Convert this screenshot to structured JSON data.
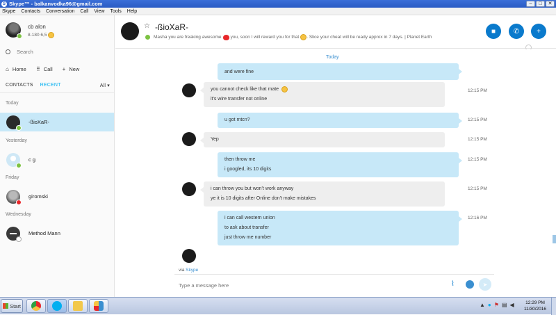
{
  "window": {
    "title": "Skype™ - balkanvodka96@gmail.com",
    "buttons": [
      "–",
      "□",
      "✕"
    ]
  },
  "menu": [
    "Skype",
    "Contacts",
    "Conversation",
    "Call",
    "View",
    "Tools",
    "Help"
  ],
  "profile": {
    "name": "cb alon",
    "mood": "8-180 6,5"
  },
  "sidebar": {
    "search_label": "Search",
    "nav": {
      "home": "Home",
      "call": "Call",
      "new": "New"
    },
    "tabs": {
      "contacts": "CONTACTS",
      "recent": "RECENT",
      "filter": "All"
    },
    "sections": [
      {
        "label": "Today",
        "contacts": [
          {
            "name": "-ßioXaR-",
            "status": "online"
          }
        ]
      },
      {
        "label": "Yesterday",
        "contacts": [
          {
            "name": "c g",
            "status": "online"
          }
        ]
      },
      {
        "label": "Friday",
        "contacts": [
          {
            "name": "giromski",
            "status": "dnd"
          }
        ]
      },
      {
        "label": "Wednesday",
        "contacts": [
          {
            "name": "Method Mann",
            "status": "offline"
          }
        ]
      }
    ]
  },
  "conversation": {
    "name": "-ßioXaR-",
    "mood_part1": "Masha you are freaking awesome",
    "mood_part2": " you, soon I will reward you for that",
    "mood_part3": ". Slice your cheat will be ready approx in 7 days. | Planet Earth",
    "date_divider": "Today",
    "messages": [
      {
        "dir": "out",
        "lines": [
          "and were fine"
        ],
        "time": ""
      },
      {
        "dir": "in",
        "lines": [
          "you cannot check like that mate",
          "it's wire transfer not online"
        ],
        "time": "12:15 PM"
      },
      {
        "dir": "out",
        "lines": [
          "u got mtcn?"
        ],
        "time": "12:15 PM"
      },
      {
        "dir": "in",
        "lines": [
          "Yep"
        ],
        "time": "12:15 PM"
      },
      {
        "dir": "out",
        "lines": [
          "then throw me",
          "i googled, its 10 digits"
        ],
        "time": "12:15 PM"
      },
      {
        "dir": "in",
        "lines": [
          "i can throw you but won't work anyway",
          "ye it is 10 digits after Online don't make mistakes"
        ],
        "time": "12:15 PM"
      },
      {
        "dir": "out",
        "lines": [
          "i can call western union",
          "to ask about transfer",
          "just throw me number"
        ],
        "time": "12:16 PM"
      }
    ],
    "via_prefix": "via",
    "via_link": "Skype",
    "input_placeholder": "Type a message here"
  },
  "taskbar": {
    "start_label": "Start",
    "clock_time": "12:29 PM",
    "clock_date": "11/30/2016"
  },
  "colors": {
    "accent": "#00aff0",
    "button_blue": "#0a7acc",
    "out_bubble": "#c7e8f8",
    "in_bubble": "#eeeeee",
    "online": "#7cc242"
  }
}
